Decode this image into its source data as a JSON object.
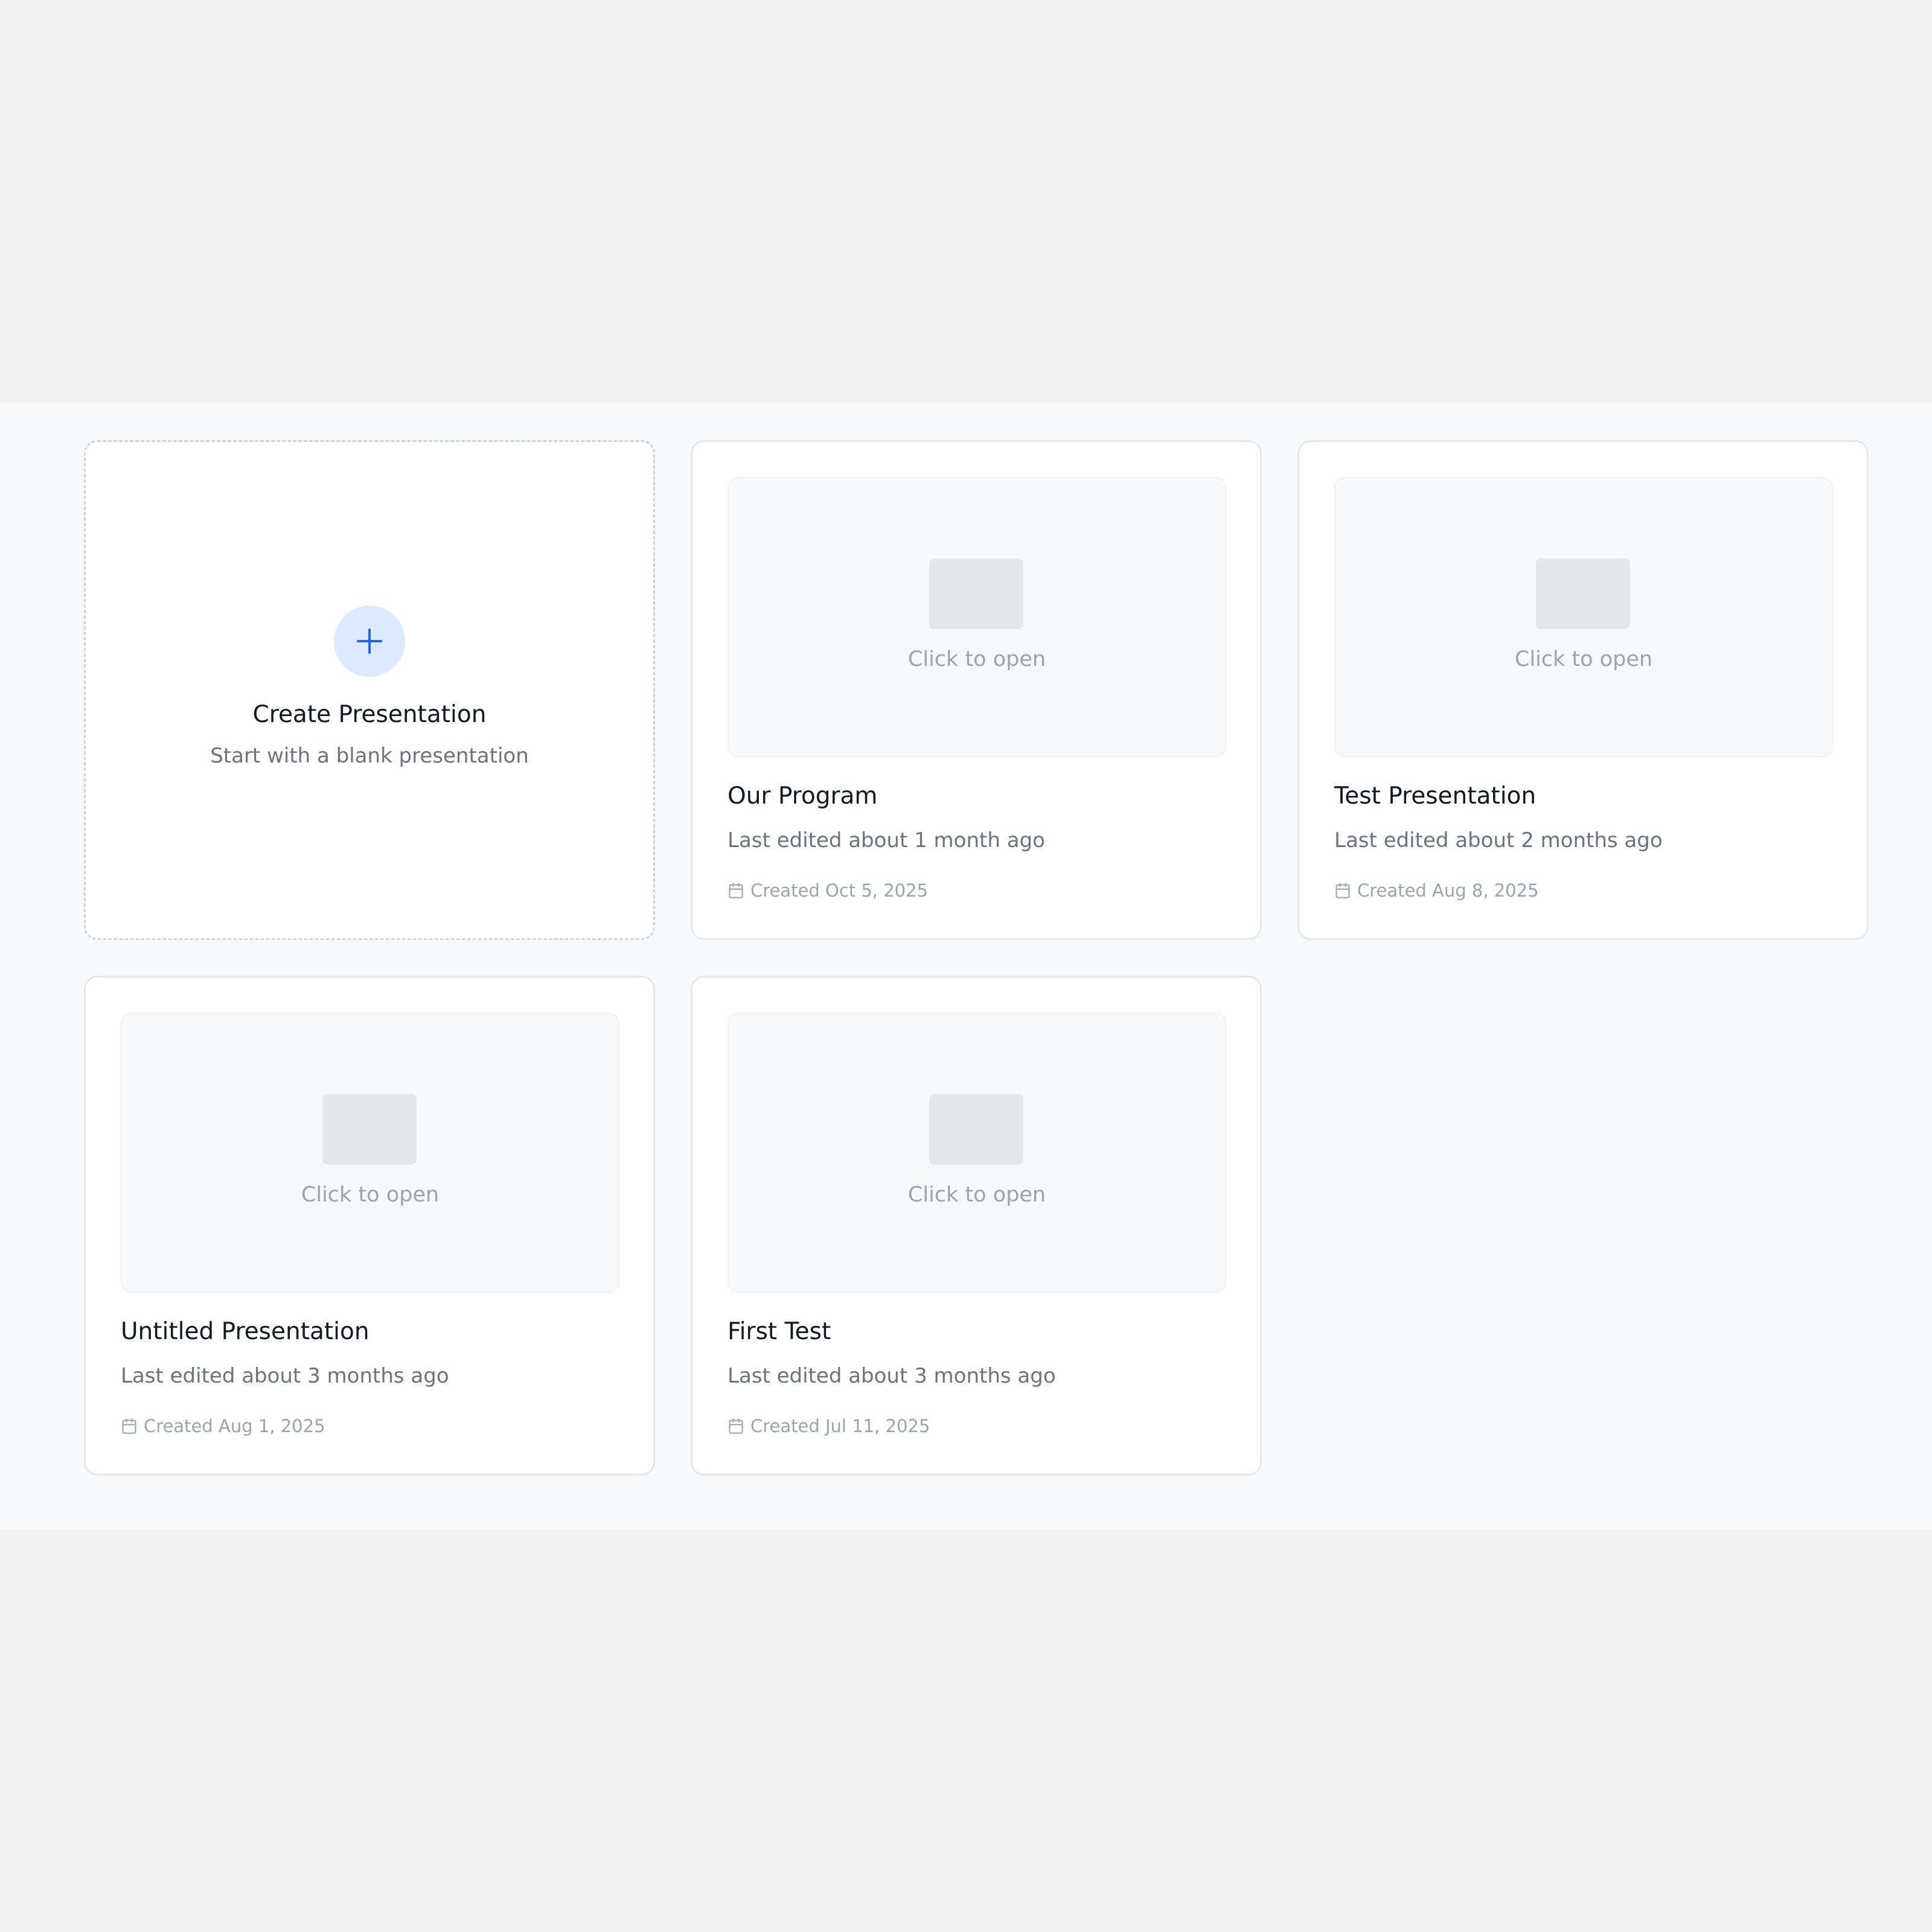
{
  "create_card": {
    "icon": "plus-icon",
    "title": "Create Presentation",
    "subtitle": "Start with a blank presentation"
  },
  "presentations": [
    {
      "thumbnail_text": "Click to open",
      "title": "Our Program",
      "edited": "Last edited about 1 month ago",
      "created": "Created Oct 5, 2025"
    },
    {
      "thumbnail_text": "Click to open",
      "title": "Test Presentation",
      "edited": "Last edited about 2 months ago",
      "created": "Created Aug 8, 2025"
    },
    {
      "thumbnail_text": "Click to open",
      "title": "Untitled Presentation",
      "edited": "Last edited about 3 months ago",
      "created": "Created Aug 1, 2025"
    },
    {
      "thumbnail_text": "Click to open",
      "title": "First Test",
      "edited": "Last edited about 3 months ago",
      "created": "Created Jul 11, 2025"
    }
  ],
  "colors": {
    "accent": "#2563eb",
    "accent_soft": "#dbeafe",
    "title_text": "#111827",
    "muted_text": "#6b7280",
    "faint_text": "#9ca3af"
  }
}
